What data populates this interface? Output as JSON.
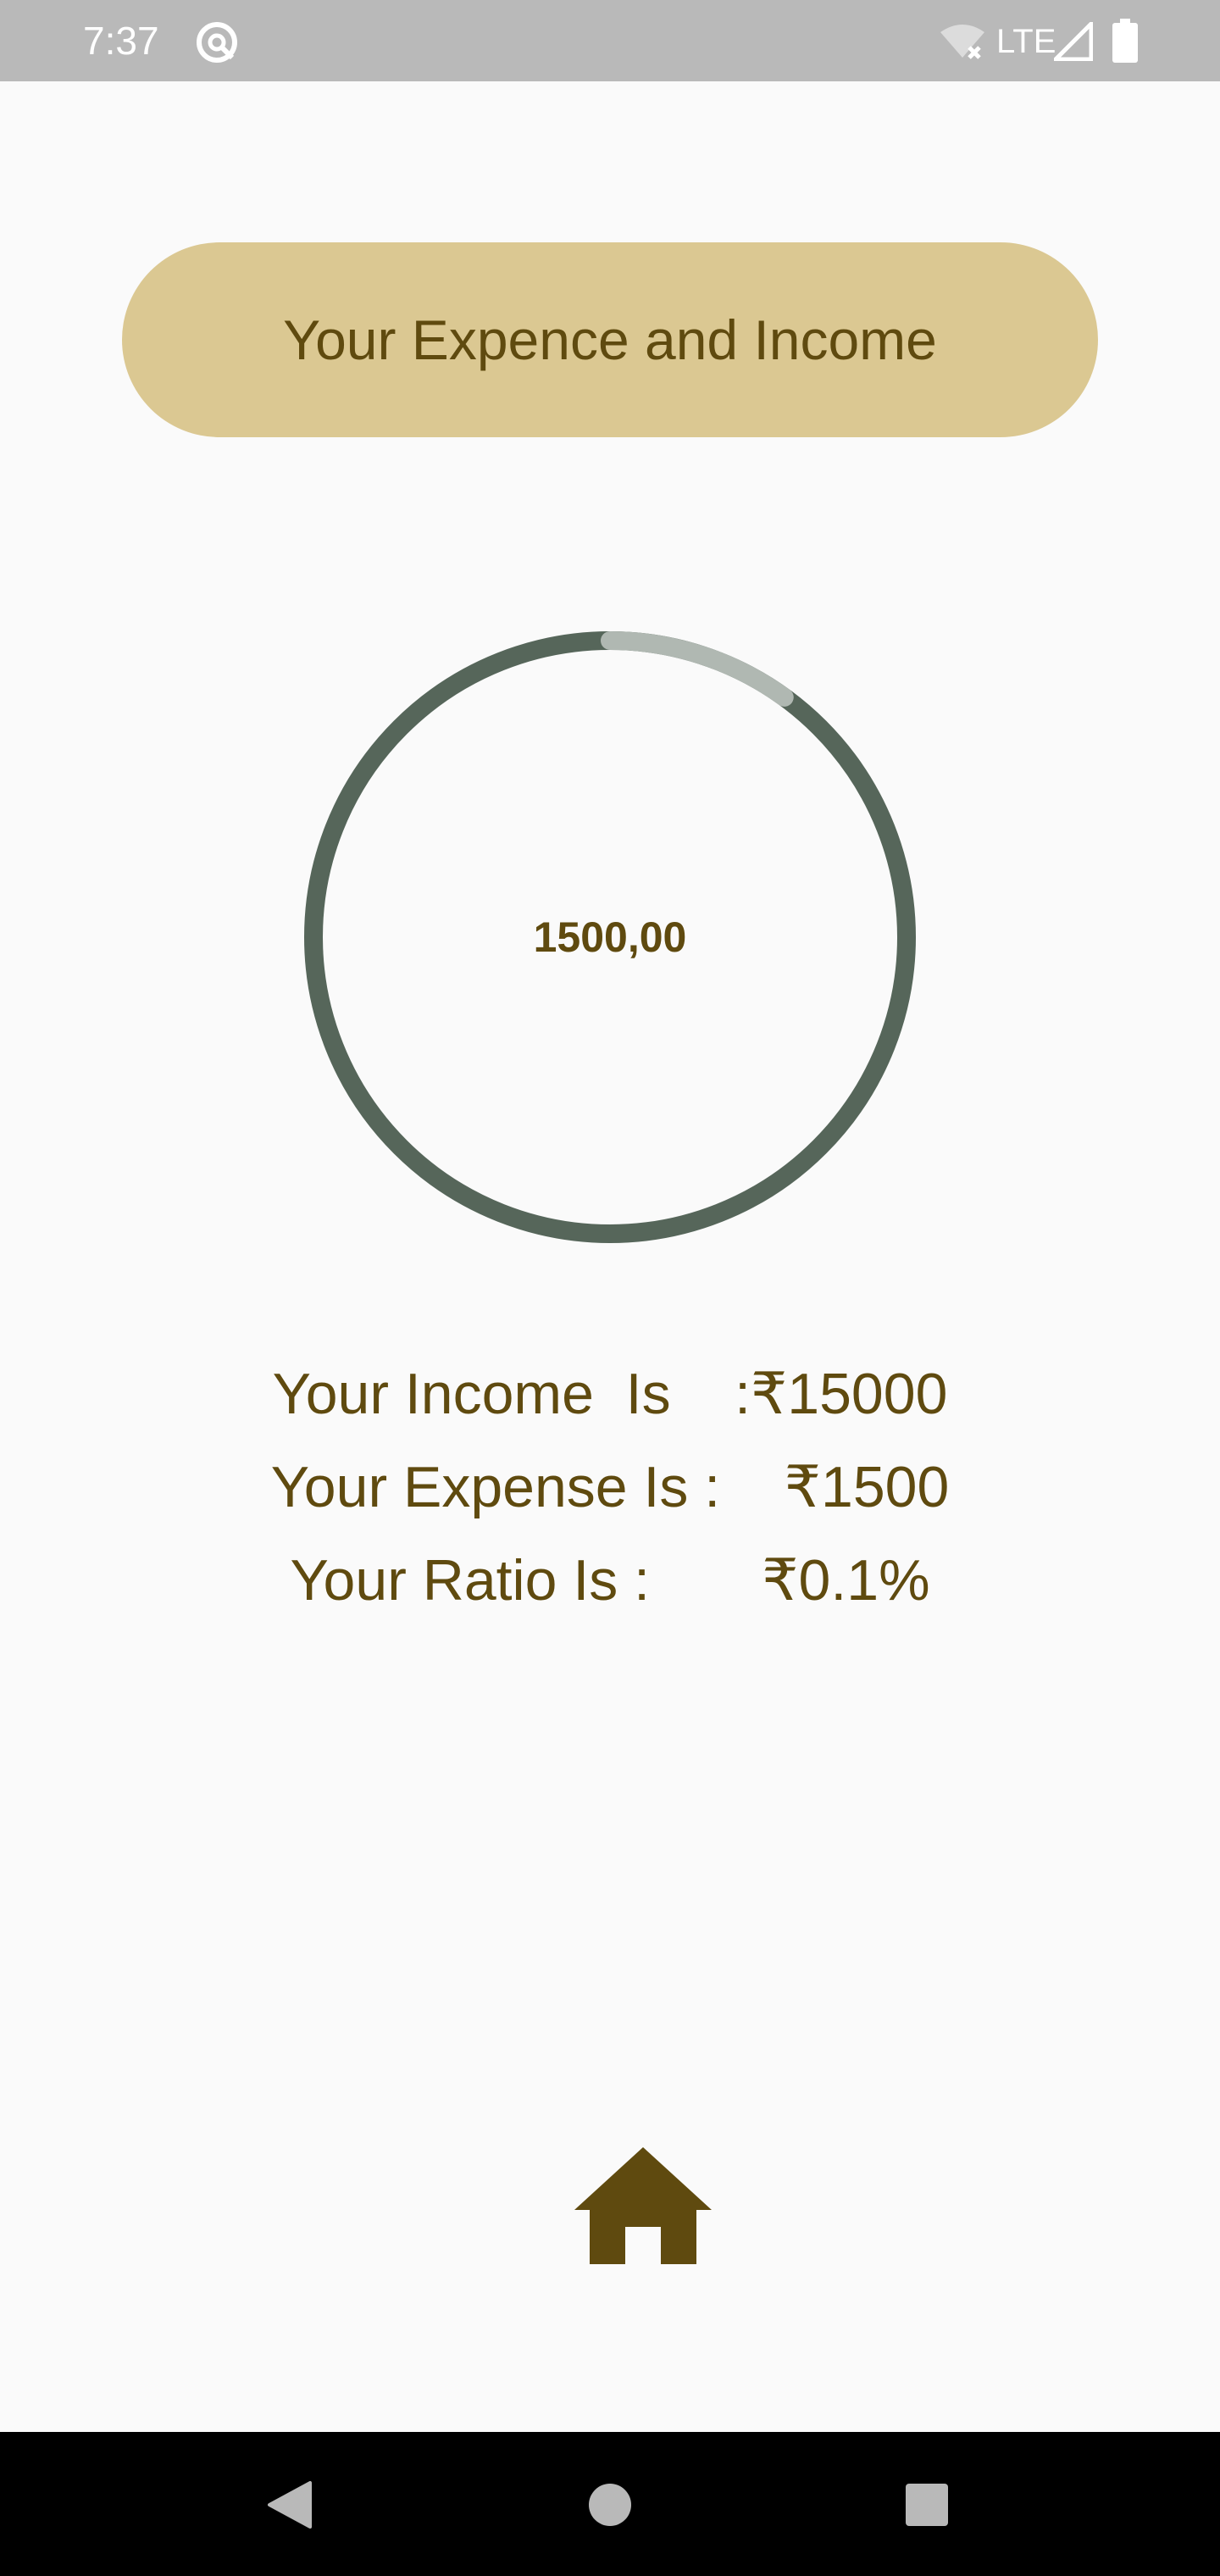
{
  "status_bar": {
    "time": "7:37",
    "network": "LTE",
    "icons": [
      "app-notification-icon",
      "wifi-off-icon",
      "signal-icon",
      "battery-icon"
    ]
  },
  "header": {
    "title": "Your Expence and Income"
  },
  "ring": {
    "center_value": "1500,00",
    "progress_fraction": 0.1,
    "track_color": "#56665a",
    "progress_color": "#b0b8b2"
  },
  "stats": {
    "income_label": "Your Income  Is    ",
    "income_value": ":₹15000",
    "expense_label": "Your Expense Is :    ",
    "expense_value": "₹1500",
    "ratio_label": "Your Ratio Is :       ",
    "ratio_value": "₹0.1%"
  },
  "bottom_nav": {
    "home_icon": "home-icon"
  },
  "system_nav": {
    "icons": [
      "back-icon",
      "home-circle-icon",
      "recent-apps-icon"
    ]
  },
  "colors": {
    "accent_text": "#5f4a0f",
    "pill_bg": "#dbc892",
    "status_bar_bg": "#b9b9b9",
    "background": "#fafafa"
  }
}
